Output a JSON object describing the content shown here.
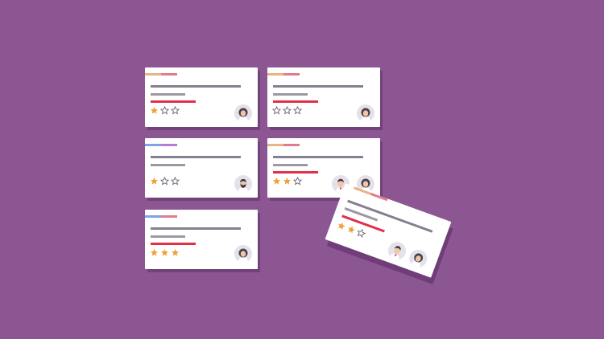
{
  "colors": {
    "background": "#8c5693",
    "card": "#ffffff",
    "line_dark": "#85808f",
    "line_light": "#9c97a3",
    "line_red": "#e2304b",
    "star_filled": "#f0a23a",
    "star_empty": "#6b6574"
  },
  "cards": [
    {
      "tag_colors": [
        "#e8b585",
        "#e07c8e"
      ],
      "rating": 1,
      "max_rating": 3,
      "has_red_bar": true,
      "avatars": [
        "woman-avatar-icon"
      ]
    },
    {
      "tag_colors": [
        "#e8b585",
        "#e07c8e"
      ],
      "rating": 0,
      "max_rating": 3,
      "has_red_bar": true,
      "avatars": [
        "woman-avatar-icon"
      ]
    },
    {
      "tag_colors": [
        "#7ea3ea",
        "#b97ad6"
      ],
      "rating": 1,
      "max_rating": 3,
      "has_red_bar": false,
      "avatars": [
        "bearded-man-avatar-icon"
      ]
    },
    {
      "tag_colors": [
        "#e8b585",
        "#e07c8e"
      ],
      "rating": 2,
      "max_rating": 3,
      "has_red_bar": true,
      "avatars": [
        "man-avatar-icon",
        "woman-avatar-icon"
      ]
    },
    {
      "tag_colors": [
        "#7ea3ea",
        "#e07c8e"
      ],
      "rating": 3,
      "max_rating": 3,
      "has_red_bar": true,
      "avatars": [
        "woman-avatar-icon"
      ]
    },
    {
      "tag_colors": [
        "#e8b585",
        "#e07c8e"
      ],
      "rating": 2,
      "max_rating": 3,
      "has_red_bar": true,
      "avatars": [
        "man-avatar-icon",
        "woman-avatar-icon"
      ]
    }
  ]
}
